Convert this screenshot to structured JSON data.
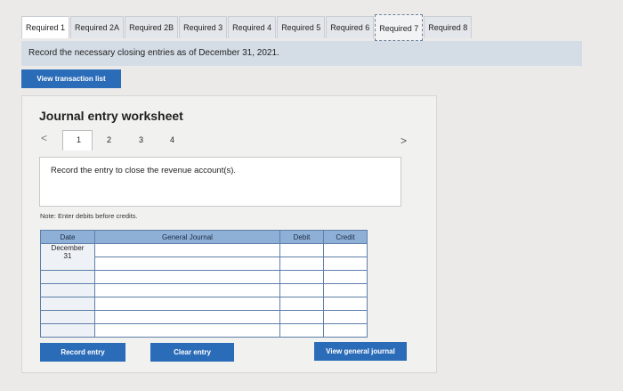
{
  "tabs": [
    {
      "label": "Required 1"
    },
    {
      "label": "Required 2A"
    },
    {
      "label": "Required 2B"
    },
    {
      "label": "Required 3"
    },
    {
      "label": "Required 4"
    },
    {
      "label": "Required 5"
    },
    {
      "label": "Required 6"
    },
    {
      "label": "Required 7"
    },
    {
      "label": "Required 8"
    }
  ],
  "banner": "Record the necessary closing entries as of December 31, 2021.",
  "view_transaction_list": "View transaction list",
  "worksheet": {
    "title": "Journal entry worksheet",
    "prev": "<",
    "next": ">",
    "pages": [
      "1",
      "2",
      "3",
      "4"
    ],
    "current_page": "1",
    "instruction": "Record the entry to close the revenue account(s).",
    "note": "Note: Enter debits before credits."
  },
  "table": {
    "headers": {
      "date": "Date",
      "account": "General Journal",
      "debit": "Debit",
      "credit": "Credit"
    },
    "date_month": "December",
    "date_day": "31"
  },
  "buttons": {
    "record": "Record entry",
    "clear": "Clear entry",
    "view_journal": "View general journal"
  },
  "colors": {
    "button": "#2b6cb8",
    "table_header": "#8fb0d6",
    "banner": "#d4dde6"
  }
}
